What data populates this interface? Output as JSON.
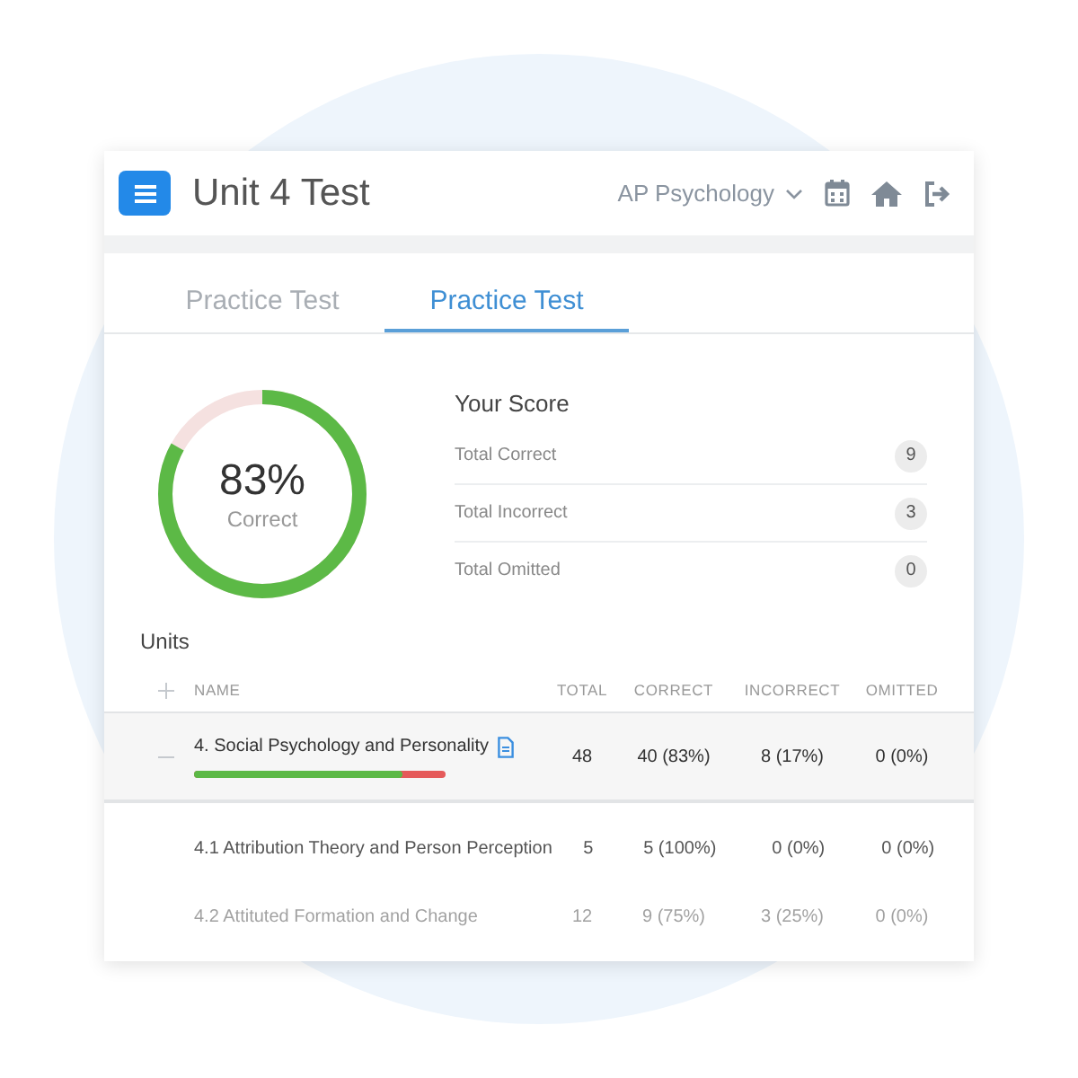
{
  "header": {
    "title": "Unit 4 Test",
    "course": "AP Psychology"
  },
  "tabs": [
    {
      "label": "Practice Test",
      "selected": false
    },
    {
      "label": "Practice Test",
      "selected": true
    }
  ],
  "score": {
    "percent": "83%",
    "caption": "Correct",
    "level": 0.83,
    "heading": "Your Score",
    "rows": [
      {
        "label": "Total Correct",
        "count": "9"
      },
      {
        "label": "Total Incorrect",
        "count": "3"
      },
      {
        "label": "Total Omitted",
        "count": "0"
      }
    ]
  },
  "units": {
    "heading": "Units",
    "columns": [
      "NAME",
      "TOTAL",
      "CORRECT",
      "INCORRECT",
      "OMITTED"
    ],
    "rows": [
      {
        "kind": "unit",
        "expanded": true,
        "name": "4. Social Psychology and Personality",
        "total": "48",
        "correct": "40 (83%)",
        "incorrect": "8 (17%)",
        "omitted": "0 (0%)",
        "level": 0.83,
        "faded": false
      },
      {
        "kind": "topic",
        "name": "4.1 Attribution Theory and Person Perception",
        "total": "5",
        "correct": "5 (100%)",
        "incorrect": "0 (0%)",
        "omitted": "0 (0%)",
        "faded": false
      },
      {
        "kind": "topic",
        "name": "4.2 Attituted Formation and Change",
        "total": "12",
        "correct": "9 (75%)",
        "incorrect": "3 (25%)",
        "omitted": "0 (0%)",
        "faded": true
      }
    ]
  }
}
